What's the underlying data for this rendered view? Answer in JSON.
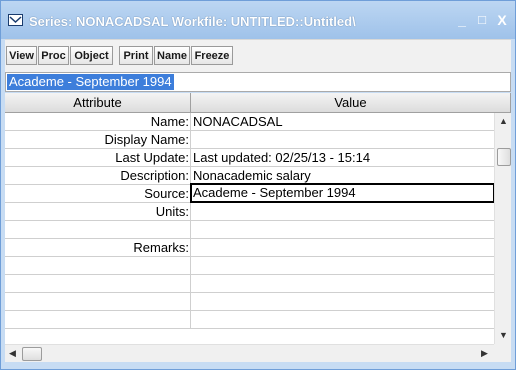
{
  "window": {
    "title": "Series: NONACADSAL   Workfile: UNTITLED::Untitled\\",
    "minimize_glyph": "_",
    "maximize_glyph": "□",
    "close_glyph": "X"
  },
  "toolbar": {
    "view": "View",
    "proc": "Proc",
    "object": "Object",
    "print": "Print",
    "name": "Name",
    "freeze": "Freeze"
  },
  "edit_line": {
    "value": "Academe - September 1994"
  },
  "table": {
    "headers": {
      "attribute": "Attribute",
      "value": "Value"
    },
    "rows": [
      {
        "attr": "Name:",
        "value": "NONACADSAL"
      },
      {
        "attr": "Display Name:",
        "value": ""
      },
      {
        "attr": "Last Update:",
        "value": "Last updated: 02/25/13 - 15:14"
      },
      {
        "attr": "Description:",
        "value": "Nonacademic salary"
      },
      {
        "attr": "Source:",
        "value": "Academe - September 1994"
      },
      {
        "attr": "Units:",
        "value": ""
      },
      {
        "attr": "",
        "value": ""
      },
      {
        "attr": "Remarks:",
        "value": ""
      },
      {
        "attr": "",
        "value": ""
      },
      {
        "attr": "",
        "value": ""
      },
      {
        "attr": "",
        "value": ""
      },
      {
        "attr": "",
        "value": ""
      }
    ]
  },
  "colors": {
    "title_bar": "#9fc2ea",
    "selection": "#3d7edb"
  }
}
